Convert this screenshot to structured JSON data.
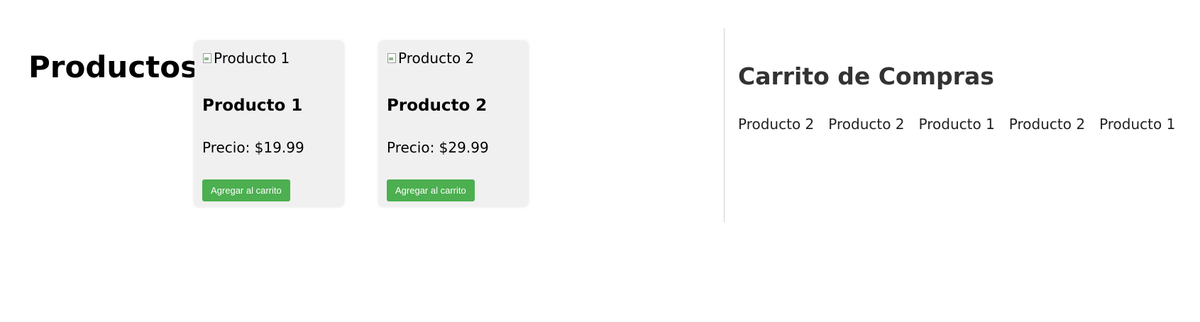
{
  "products_section": {
    "title": "Productos",
    "items": [
      {
        "image_alt": "Producto 1",
        "name": "Producto 1",
        "price": "Precio: $19.99",
        "button_label": "Agregar al carrito"
      },
      {
        "image_alt": "Producto 2",
        "name": "Producto 2",
        "price": "Precio: $29.99",
        "button_label": "Agregar al carrito"
      }
    ]
  },
  "cart": {
    "title": "Carrito de Compras",
    "items": [
      "Producto 2",
      "Producto 2",
      "Producto 1",
      "Producto 2",
      "Producto 1"
    ]
  },
  "colors": {
    "button_bg": "#4caf50",
    "card_bg": "#f0f0f0",
    "cart_title": "#333333"
  }
}
